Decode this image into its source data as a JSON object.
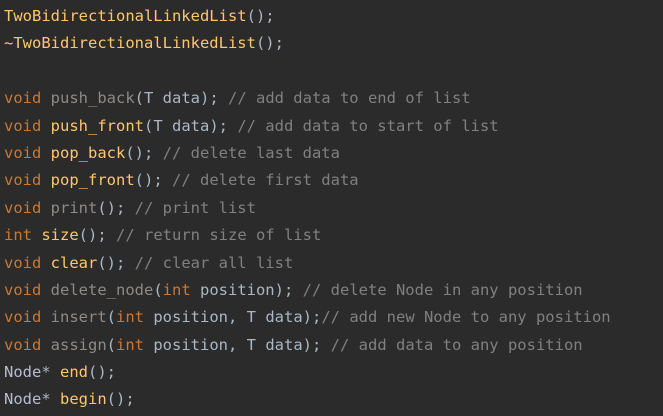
{
  "colors": {
    "background": "#2b2b2b",
    "keyword": "#cc7832",
    "function": "#ffc66d",
    "function_unused": "#8e8a87",
    "identifier": "#a9b7c6",
    "comment": "#808080",
    "type": "#b9bcd1"
  },
  "lines": [
    {
      "tokens": [
        {
          "t": "TwoBidirectionalLinkedList",
          "c": "fn"
        },
        {
          "t": "();",
          "c": "plain"
        }
      ]
    },
    {
      "tokens": [
        {
          "t": "~TwoBidirectionalLinkedList",
          "c": "fn"
        },
        {
          "t": "();",
          "c": "plain"
        }
      ]
    },
    {
      "tokens": []
    },
    {
      "tokens": [
        {
          "t": "void",
          "c": "kw"
        },
        {
          "t": " push_back",
          "c": "fn-muted"
        },
        {
          "t": "(T ",
          "c": "plain"
        },
        {
          "t": "data",
          "c": "param"
        },
        {
          "t": ");",
          "c": "plain"
        },
        {
          "t": " // add data to end of list",
          "c": "comment"
        }
      ]
    },
    {
      "tokens": [
        {
          "t": "void",
          "c": "kw"
        },
        {
          "t": " push_front",
          "c": "fn"
        },
        {
          "t": "(T ",
          "c": "plain"
        },
        {
          "t": "data",
          "c": "param"
        },
        {
          "t": ");",
          "c": "plain"
        },
        {
          "t": " // add data to start of list",
          "c": "comment"
        }
      ]
    },
    {
      "tokens": [
        {
          "t": "void",
          "c": "kw"
        },
        {
          "t": " pop_back",
          "c": "fn"
        },
        {
          "t": "();",
          "c": "plain"
        },
        {
          "t": " // delete last data",
          "c": "comment"
        }
      ]
    },
    {
      "tokens": [
        {
          "t": "void",
          "c": "kw"
        },
        {
          "t": " pop_front",
          "c": "fn"
        },
        {
          "t": "();",
          "c": "plain"
        },
        {
          "t": " // delete first data",
          "c": "comment"
        }
      ]
    },
    {
      "tokens": [
        {
          "t": "void",
          "c": "kw"
        },
        {
          "t": " print",
          "c": "fn-muted"
        },
        {
          "t": "();",
          "c": "plain"
        },
        {
          "t": " // print list",
          "c": "comment"
        }
      ]
    },
    {
      "tokens": [
        {
          "t": "int",
          "c": "kw"
        },
        {
          "t": " size",
          "c": "fn"
        },
        {
          "t": "();",
          "c": "plain"
        },
        {
          "t": " // return size of list",
          "c": "comment"
        }
      ]
    },
    {
      "tokens": [
        {
          "t": "void",
          "c": "kw"
        },
        {
          "t": " clear",
          "c": "fn"
        },
        {
          "t": "();",
          "c": "plain"
        },
        {
          "t": " // clear all list",
          "c": "comment"
        }
      ]
    },
    {
      "tokens": [
        {
          "t": "void",
          "c": "kw"
        },
        {
          "t": " delete_node",
          "c": "fn-muted"
        },
        {
          "t": "(",
          "c": "plain"
        },
        {
          "t": "int",
          "c": "kw"
        },
        {
          "t": " position",
          "c": "param"
        },
        {
          "t": ");",
          "c": "plain"
        },
        {
          "t": " // delete Node in any position",
          "c": "comment"
        }
      ]
    },
    {
      "tokens": [
        {
          "t": "void",
          "c": "kw"
        },
        {
          "t": " insert",
          "c": "fn-muted"
        },
        {
          "t": "(",
          "c": "plain"
        },
        {
          "t": "int",
          "c": "kw"
        },
        {
          "t": " position",
          "c": "param"
        },
        {
          "t": ", T ",
          "c": "plain"
        },
        {
          "t": "data",
          "c": "param"
        },
        {
          "t": ");",
          "c": "plain"
        },
        {
          "t": "// add new Node to any position",
          "c": "comment"
        }
      ]
    },
    {
      "tokens": [
        {
          "t": "void",
          "c": "kw"
        },
        {
          "t": " assign",
          "c": "fn-muted"
        },
        {
          "t": "(",
          "c": "plain"
        },
        {
          "t": "int",
          "c": "kw"
        },
        {
          "t": " position",
          "c": "param"
        },
        {
          "t": ", T ",
          "c": "plain"
        },
        {
          "t": "data",
          "c": "param"
        },
        {
          "t": ");",
          "c": "plain"
        },
        {
          "t": " // add data to any position",
          "c": "comment"
        }
      ]
    },
    {
      "tokens": [
        {
          "t": "Node",
          "c": "type"
        },
        {
          "t": "*",
          "c": "plain"
        },
        {
          "t": " end",
          "c": "fn"
        },
        {
          "t": "();",
          "c": "plain"
        }
      ]
    },
    {
      "tokens": [
        {
          "t": "Node",
          "c": "type"
        },
        {
          "t": "*",
          "c": "plain"
        },
        {
          "t": " begin",
          "c": "fn"
        },
        {
          "t": "();",
          "c": "plain"
        }
      ]
    }
  ]
}
